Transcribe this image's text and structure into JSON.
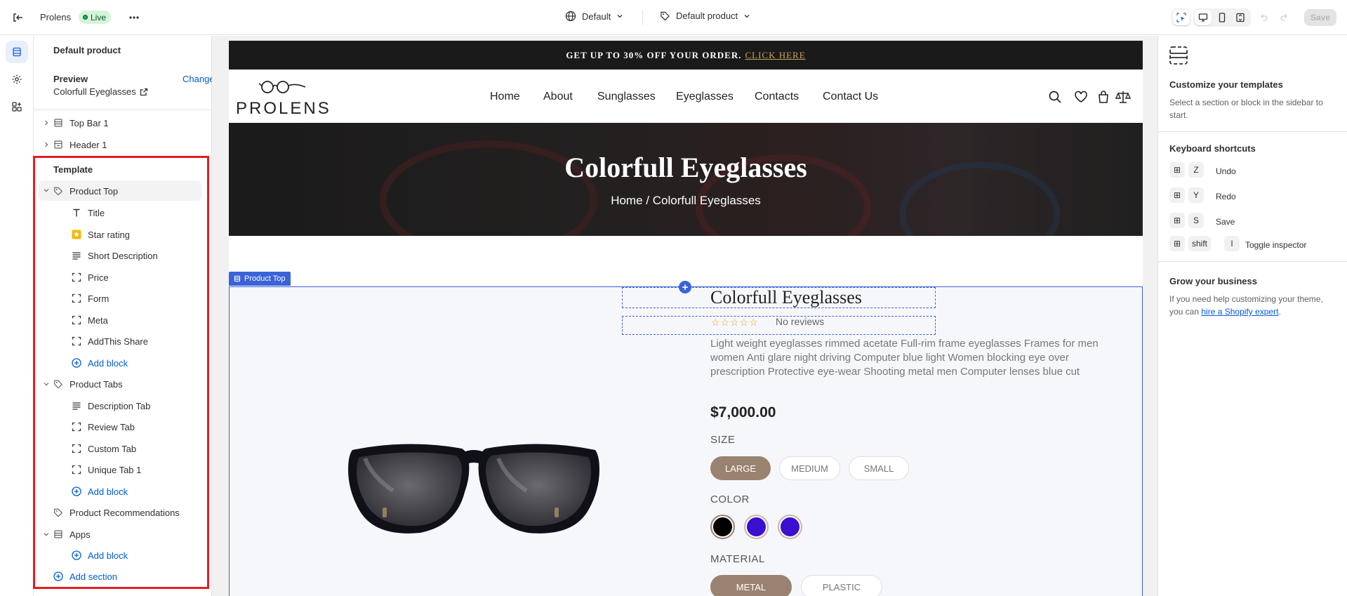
{
  "topbar": {
    "store_name": "Prolens",
    "status_badge": "Live",
    "theme_selector": "Default",
    "template_selector": "Default product",
    "save_label": "Save"
  },
  "sidebar": {
    "title": "Default product",
    "preview_label": "Preview",
    "preview_change": "Change",
    "preview_product": "Colorfull Eyeglasses",
    "sections_top": [
      {
        "label": "Top Bar 1",
        "icon": "section-icon"
      },
      {
        "label": "Header 1",
        "icon": "header-icon"
      }
    ],
    "template_heading": "Template",
    "template_sections": [
      {
        "label": "Product Top",
        "icon": "tag-icon",
        "blocks": [
          {
            "label": "Title",
            "icon": "text-icon"
          },
          {
            "label": "Star rating",
            "icon": "star-app-icon"
          },
          {
            "label": "Short Description",
            "icon": "paragraph-icon"
          },
          {
            "label": "Price",
            "icon": "block-icon"
          },
          {
            "label": "Form",
            "icon": "block-icon"
          },
          {
            "label": "Meta",
            "icon": "block-icon"
          },
          {
            "label": "AddThis Share",
            "icon": "block-icon"
          }
        ],
        "add_block": "Add block"
      },
      {
        "label": "Product Tabs",
        "icon": "tag-icon",
        "blocks": [
          {
            "label": "Description Tab",
            "icon": "paragraph-icon"
          },
          {
            "label": "Review Tab",
            "icon": "block-icon"
          },
          {
            "label": "Custom Tab",
            "icon": "block-icon"
          },
          {
            "label": "Unique Tab 1",
            "icon": "block-icon"
          }
        ],
        "add_block": "Add block"
      }
    ],
    "product_recommendations": "Product Recommendations",
    "apps_label": "Apps",
    "apps_add_block": "Add block",
    "add_section": "Add section",
    "highlight_color": "#e51c23"
  },
  "store": {
    "announcement_text": "GET UP TO 30% OFF YOUR ORDER.",
    "announcement_link": "CLICK HERE",
    "logo_text": "PROLENS",
    "nav": [
      "Home",
      "About",
      "Sunglasses",
      "Eyeglasses",
      "Contacts",
      "Contact Us"
    ],
    "hero_title": "Colorfull Eyeglasses",
    "breadcrumb_home": "Home",
    "breadcrumb_sep": "/",
    "breadcrumb_current": "Colorfull Eyeglasses",
    "section_label": "Product Top",
    "product": {
      "title": "Colorfull Eyeglasses",
      "stars": "☆☆☆☆☆",
      "reviews": "No reviews",
      "description": "Light weight eyeglasses rimmed acetate Full-rim frame eyeglasses Frames for men women Anti glare night driving Computer blue light Women blocking eye over prescription Protective eye-wear Shooting metal men Computer lenses blue cut",
      "price": "$7,000.00",
      "size_label": "SIZE",
      "sizes": [
        "LARGE",
        "MEDIUM",
        "SMALL"
      ],
      "selected_size": "LARGE",
      "color_label": "COLOR",
      "colors": [
        "#000000",
        "#3a0fd0",
        "#3a0fd0"
      ],
      "material_label": "MATERIAL",
      "materials": [
        "METAL",
        "PLASTIC"
      ],
      "selected_material": "METAL"
    }
  },
  "right_panel": {
    "customize_title": "Customize your templates",
    "customize_text": "Select a section or block in the sidebar to start.",
    "shortcuts_title": "Keyboard shortcuts",
    "shortcuts": [
      {
        "keys": [
          "Z"
        ],
        "label": "Undo"
      },
      {
        "keys": [
          "Y"
        ],
        "label": "Redo"
      },
      {
        "keys": [
          "S"
        ],
        "label": "Save"
      },
      {
        "keys": [
          "shift",
          "I"
        ],
        "label": "Toggle inspector"
      }
    ],
    "grow_title": "Grow your business",
    "grow_text": "If you need help customizing your theme, you can",
    "grow_link": "hire a Shopify expert",
    "grow_end": "."
  }
}
